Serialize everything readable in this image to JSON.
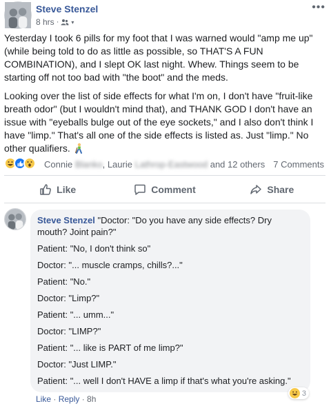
{
  "post": {
    "author": "Steve Stenzel",
    "time": "8 hrs",
    "audience_icon": "friends-icon",
    "more_icon": "more-options-icon",
    "paragraphs": [
      "Yesterday I took 6 pills for my foot that I was warned would \"amp me up\" (while being told to do as little as possible, so THAT'S A FUN COMBINATION), and I slept OK last night. Whew. Things seem to be starting off not too bad with \"the boot\" and the meds.",
      "Looking over the list of side effects for what I'm on, I don't have \"fruit-like breath odor\" (but I wouldn't mind that), and THANK GOD I don't have an issue with \"eyeballs bulge out of the eye sockets,\" and I also don't think I have \"limp.\" That's all one of the side effects is listed as. Just \"limp.\" No other qualifiers."
    ],
    "paragraph_emoji": "person-limping-emoji"
  },
  "reactions": {
    "icons": [
      "haha",
      "like",
      "wow"
    ],
    "reactor1_first": "Connie",
    "reactor1_last": "Blanko",
    "reactor2_first": "Laurie",
    "reactor2_last": "Lathrop-Eastwood",
    "others": "and 12 others",
    "comment_count": "7 Comments"
  },
  "actions": {
    "like": "Like",
    "comment": "Comment",
    "share": "Share"
  },
  "comment": {
    "author": "Steve Stenzel",
    "lines": [
      "\"Doctor: \"Do you have any side effects? Dry mouth? Joint pain?\"",
      "Patient: \"No, I don't think so\"",
      "Doctor: \"... muscle cramps, chills?...\"",
      "Patient: \"No.\"",
      "Doctor: \"Limp?\"",
      "Patient: \"... umm...\"",
      "Doctor: \"LIMP?\"",
      "Patient: \"... like is PART of me limp?\"",
      "Doctor: \"Just LIMP.\"",
      "Patient: \"... well I don't HAVE a limp if that's what you're asking.\""
    ],
    "reaction_count": "3",
    "like": "Like",
    "reply": "Reply",
    "time": "8h"
  },
  "colors": {
    "link_blue": "#385898",
    "like_blue": "#1877f2",
    "secondary_text": "#616770",
    "bubble_bg": "#f2f3f5"
  }
}
